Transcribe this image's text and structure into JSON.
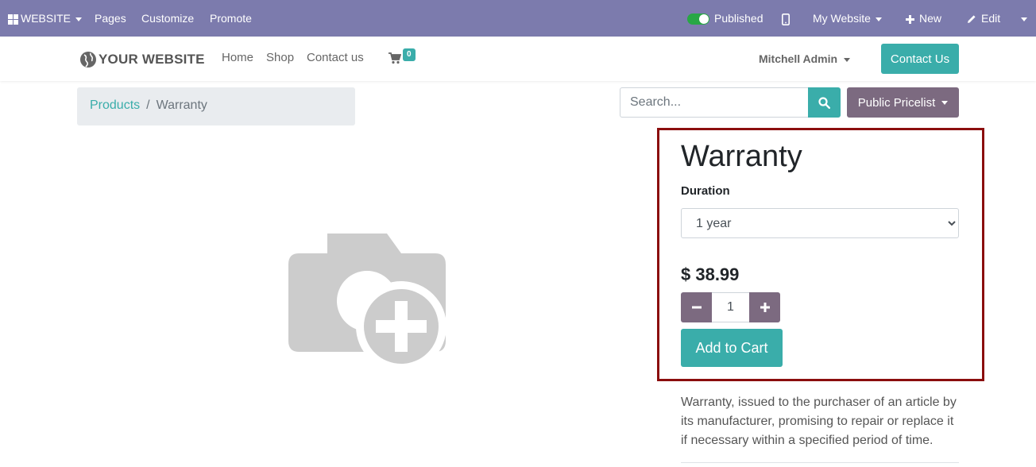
{
  "adminbar": {
    "website_menu": "WEBSITE",
    "pages": "Pages",
    "customize": "Customize",
    "promote": "Promote",
    "published": "Published",
    "my_website": "My Website",
    "new": "New",
    "edit": "Edit"
  },
  "header": {
    "logo_text": "YOUR WEBSITE",
    "nav": [
      "Home",
      "Shop",
      "Contact us"
    ],
    "cart_count": "0",
    "user": "Mitchell Admin",
    "contact_button": "Contact Us"
  },
  "breadcrumb": {
    "parent": "Products",
    "separator": "/",
    "current": "Warranty"
  },
  "search": {
    "placeholder": "Search...",
    "pricelist": "Public Pricelist"
  },
  "product": {
    "name": "Warranty",
    "attribute_label": "Duration",
    "selected_option": "1 year",
    "price": "$ 38.99",
    "quantity": "1",
    "add_to_cart": "Add to Cart",
    "description": "Warranty, issued to the purchaser of an article by its manufacturer, promising to repair or replace it if necessary within a specified period of time."
  },
  "colors": {
    "adminbar": "#7c7bad",
    "primary": "#3aadaa",
    "secondary": "#7c6a80",
    "highlight": "#8b0e0e"
  }
}
